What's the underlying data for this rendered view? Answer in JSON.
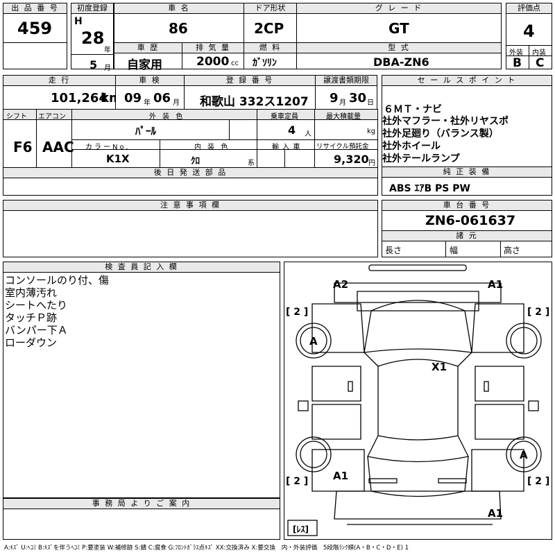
{
  "lot": {
    "label": "出 品 番 号",
    "value": "459"
  },
  "first_reg": {
    "label": "初度登録",
    "era": "H",
    "year": "28",
    "year_unit": "年",
    "month": "5",
    "month_unit": "月"
  },
  "car_name": {
    "label": "車 名",
    "value": "86"
  },
  "door": {
    "label": "ドア形状",
    "value": "2CP"
  },
  "grade": {
    "label": "グ レ ー ド",
    "value": "GT"
  },
  "score": {
    "label": "評価点",
    "value": "4"
  },
  "history": {
    "label": "車 歴",
    "value": "自家用"
  },
  "displacement": {
    "label": "排 気 量",
    "value": "2000",
    "unit": "cc"
  },
  "fuel": {
    "label": "燃 料",
    "value": "ｶﾞｿﾘﾝ"
  },
  "model": {
    "label": "型 式",
    "value": "DBA-ZN6"
  },
  "exterior": {
    "label": "外装",
    "value": "B"
  },
  "interior": {
    "label": "内装",
    "value": "C"
  },
  "mileage": {
    "label": "走 行",
    "value": "101,264",
    "unit": "km"
  },
  "inspection": {
    "label": "車 検",
    "year": "09",
    "year_unit": "年",
    "month": "06",
    "month_unit": "月"
  },
  "registration": {
    "label": "登 録 番 号",
    "value": "和歌山 332ス1207"
  },
  "transfer": {
    "label": "譲渡書類期限",
    "month": "9",
    "month_unit": "月",
    "day": "30",
    "day_unit": "日"
  },
  "sales_points": {
    "label": "セ ー ル ス ポ イ ン ト",
    "lines": [
      "６ＭＴ・ナビ",
      "社外マフラー・社外リヤスポ",
      "社外足廻り（バランス製）",
      "社外ホイール",
      "社外テールランプ"
    ]
  },
  "shift": {
    "label": "シフト",
    "value": "F6"
  },
  "aircon": {
    "label": "エアコン",
    "value": "AAC"
  },
  "ext_color": {
    "label": "外 装 色",
    "value": "ﾊﾟｰﾙ"
  },
  "capacity": {
    "label": "乗車定員",
    "value": "4",
    "unit": "人"
  },
  "max_load": {
    "label": "最大積載量",
    "value": "",
    "unit": "kg"
  },
  "color_no": {
    "label": "カラーNo.",
    "value": "K1X"
  },
  "int_color": {
    "label": "内 装 色",
    "value": "ｸﾛ",
    "unit": "系"
  },
  "import": {
    "label": "輸 入 車",
    "value": ""
  },
  "recycle": {
    "label": "リサイクル預託金",
    "value": "9,320",
    "unit": "円"
  },
  "later_parts": {
    "label": "後 日 発 送 部 品",
    "value": ""
  },
  "genuine": {
    "label": "純 正 装 備",
    "value": "ABS ｴｱB PS PW"
  },
  "caution": {
    "label": "注 意 事 項 欄",
    "value": ""
  },
  "chassis": {
    "label": "車 台 番 号",
    "value": "ZN6-061637"
  },
  "specs": {
    "label": "諸 元",
    "length": "長さ",
    "width": "幅",
    "height": "高さ"
  },
  "inspector": {
    "label": "検 査 員 記 入 欄",
    "lines": [
      "コンソールのり付、傷",
      "室内薄汚れ",
      "シートへたり",
      "タッチＰ跡",
      "バンパー下Ａ",
      "ローダウン"
    ]
  },
  "office": {
    "label": "事 務 局 よ り ご 案 内",
    "value": ""
  },
  "legend": "A:ｷｽﾞ U:ﾍｺﾐ B:ｷｽﾞを伴うﾍｺﾐ P:要塗装 W:補修跡 S:錆 C:腐食 G:ﾌﾛﾝﾄｶﾞﾗｽ点ｷｽﾞ XX:交換済み X:要交換　内・外装評価　5段階ﾗﾝｸ順(A・B・C・D・E) 1",
  "diagram": {
    "marks": {
      "rear_left": "A2",
      "rear_right": "A1",
      "center": "X1",
      "front_left": "A1",
      "front_right": "A1",
      "wheel_rl": "A",
      "wheel_fr": "A"
    },
    "tires": {
      "tl": "[ 2 ]",
      "tr": "[ 2 ]",
      "bl": "[ 2 ]",
      "br": "[ 2 ]"
    },
    "spare": "[ﾚｽ]"
  }
}
